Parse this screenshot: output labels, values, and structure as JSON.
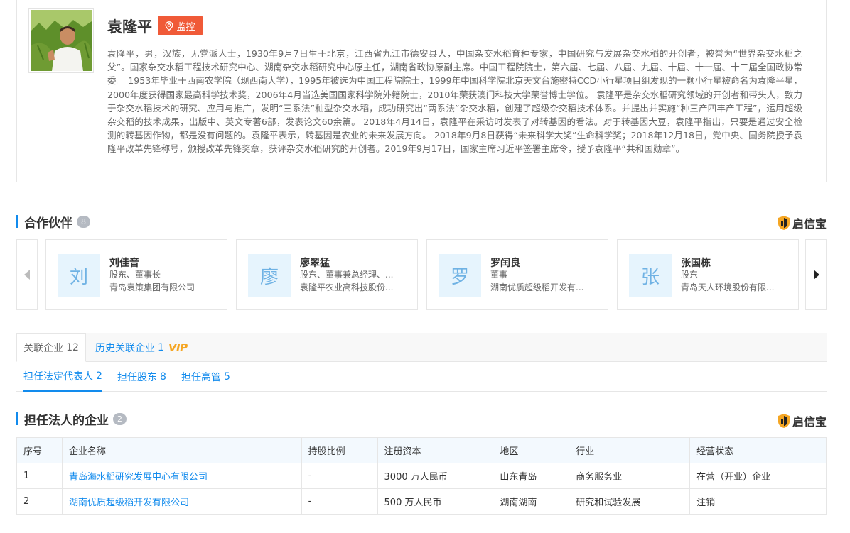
{
  "profile": {
    "name": "袁隆平",
    "monitor_label": "监控",
    "bio": "袁隆平，男，汉族，无党派人士，1930年9月7日生于北京，江西省九江市德安县人，中国杂交水稻育种专家，中国研究与发展杂交水稻的开创者，被誉为“世界杂交水稻之父”。国家杂交水稻工程技术研究中心、湖南杂交水稻研究中心原主任，湖南省政协原副主席。中国工程院院士，第六届、七届、八届、九届、十届、十一届、十二届全国政协常委。 1953年毕业于西南农学院（现西南大学），1995年被选为中国工程院院士，1999年中国科学院北京天文台施密特CCD小行星项目组发现的一颗小行星被命名为袁隆平星，2000年度获得国家最高科学技术奖，2006年4月当选美国国家科学院外籍院士，2010年荣获澳门科技大学荣誉博士学位。 袁隆平是杂交水稻研究领域的开创者和带头人，致力于杂交水稻技术的研究、应用与推广，发明“三系法”籼型杂交水稻，成功研究出“两系法”杂交水稻，创建了超级杂交稻技术体系。并提出并实施“种三产四丰产工程”，运用超级杂交稻的技术成果，出版中、英文专著6部，发表论文60余篇。 2018年4月14日，袁隆平在采访时发表了对转基因的看法。对于转基因大豆，袁隆平指出，只要是通过安全检测的转基因作物，都是没有问题的。袁隆平表示，转基因是农业的未来发展方向。 2018年9月8日获得“未来科学大奖”生命科学奖；2018年12月18日，党中央、国务院授予袁隆平改革先锋称号，颁授改革先锋奖章，获评杂交水稻研究的开创者。2019年9月17日，国家主席习近平签署主席令，授予袁隆平“共和国勋章”。"
  },
  "partners_section": {
    "title": "合作伙伴",
    "count": "8",
    "brand": "启信宝",
    "items": [
      {
        "initial": "刘",
        "name": "刘佳音",
        "role": "股东、董事长",
        "company": "青岛袁策集团有限公司"
      },
      {
        "initial": "廖",
        "name": "廖翠猛",
        "role": "股东、董事兼总经理、...",
        "company": "袁隆平农业高科技股份..."
      },
      {
        "initial": "罗",
        "name": "罗闰良",
        "role": "董事",
        "company": "湖南优质超级稻开发有..."
      },
      {
        "initial": "张",
        "name": "张国栋",
        "role": "股东",
        "company": "青岛天人环境股份有限..."
      }
    ]
  },
  "tabs": {
    "related": {
      "label": "关联企业",
      "count": "12"
    },
    "history": {
      "label": "历史关联企业",
      "count": "1",
      "vip": "VIP"
    },
    "legal_rep": {
      "label": "担任法定代表人",
      "count": "2"
    },
    "shareholder": {
      "label": "担任股东",
      "count": "8"
    },
    "executive": {
      "label": "担任高管",
      "count": "5"
    }
  },
  "legal_section": {
    "title": "担任法人的企业",
    "count": "2",
    "brand": "启信宝"
  },
  "table": {
    "headers": [
      "序号",
      "企业名称",
      "持股比例",
      "注册资本",
      "地区",
      "行业",
      "经营状态"
    ],
    "rows": [
      [
        "1",
        "青岛海水稻研究发展中心有限公司",
        "-",
        "3000 万人民币",
        "山东青岛",
        "商务服务业",
        "在营（开业）企业"
      ],
      [
        "2",
        "湖南优质超级稻开发有限公司",
        "-",
        "500 万人民币",
        "湖南湖南",
        "研究和试验发展",
        "注销"
      ]
    ]
  },
  "colors": {
    "accent": "#128bed",
    "monitor": "#f05a38",
    "status_cancelled": "#e33244"
  }
}
